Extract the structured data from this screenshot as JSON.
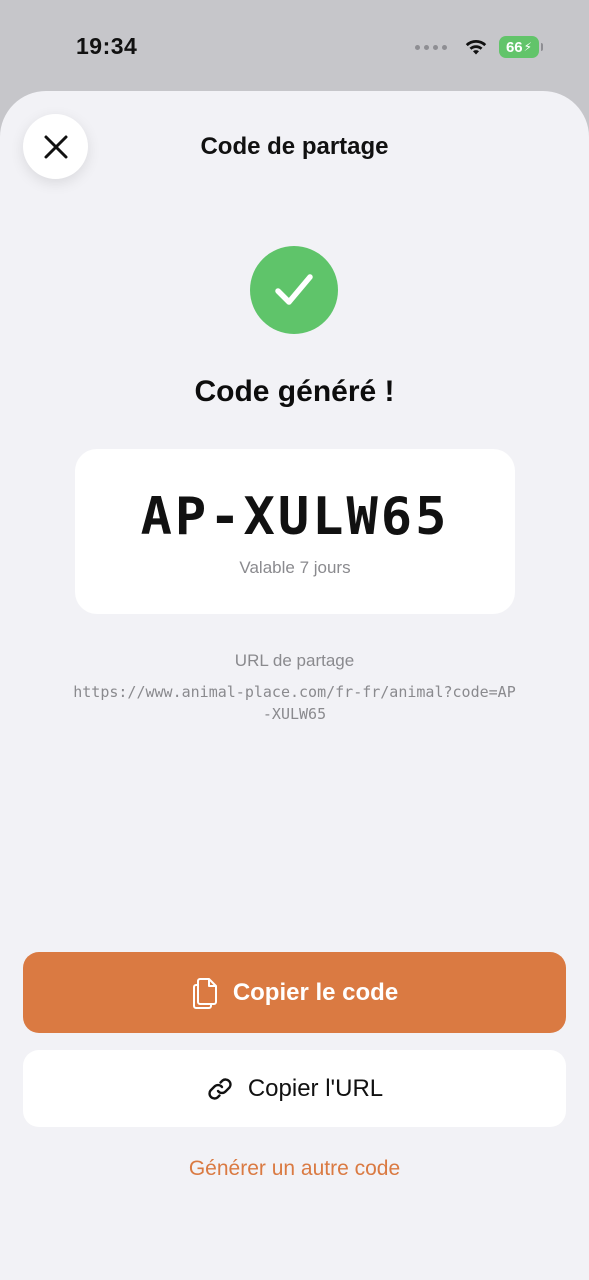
{
  "status_bar": {
    "time": "19:34",
    "battery_level": "66",
    "battery_icon": "battery-charging-icon",
    "wifi_icon": "wifi-icon"
  },
  "sheet": {
    "title": "Code de partage",
    "close_icon": "close-icon"
  },
  "result": {
    "success_icon": "checkmark-icon",
    "heading": "Code généré !",
    "code": "AP-XULW65",
    "validity": "Valable 7 jours"
  },
  "share_url": {
    "label": "URL de partage",
    "value": "https://www.animal-place.com/fr-fr/animal?code=AP-XULW65"
  },
  "actions": {
    "copy_code_label": "Copier le code",
    "copy_code_icon": "copy-icon",
    "copy_url_label": "Copier l'URL",
    "copy_url_icon": "link-icon",
    "regenerate_label": "Générer un autre code"
  },
  "colors": {
    "accent": "#da7a42",
    "success": "#5fc46a",
    "sheet_background": "#f2f2f6"
  }
}
